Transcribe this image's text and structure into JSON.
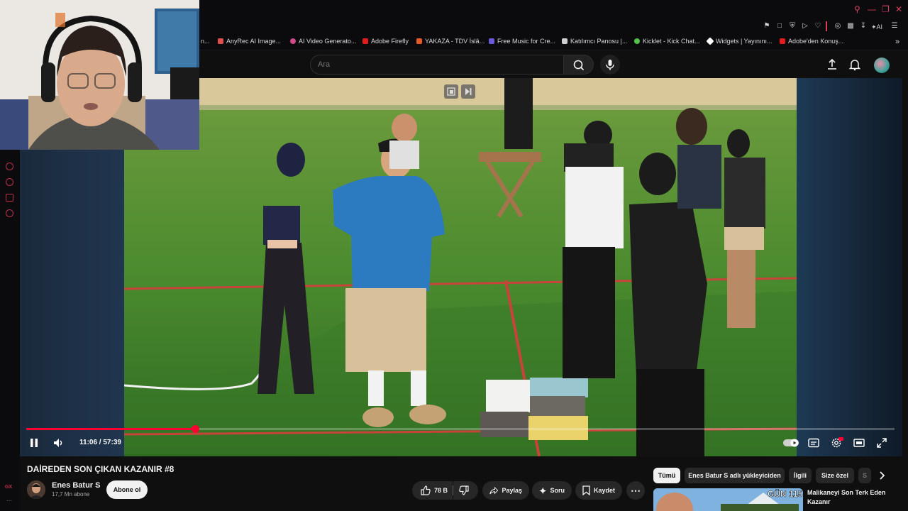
{
  "browser": {
    "bookmarks": [
      {
        "label": "n...",
        "color": "#888888"
      },
      {
        "label": "AnyRec AI Image...",
        "color": "#e05050"
      },
      {
        "label": "AI Video Generato...",
        "color": "#d04a8a"
      },
      {
        "label": "Adobe Firefly",
        "color": "#e21b1b"
      },
      {
        "label": "YAKAZA - TDV İslâ...",
        "color": "#e25a2a"
      },
      {
        "label": "Free Music for Cre...",
        "color": "#6a5ad8"
      },
      {
        "label": "Katılımcı Panosu |...",
        "color": "#cfcfcf"
      },
      {
        "label": "Kicklet - Kick Chat...",
        "color": "#53c24a"
      },
      {
        "label": "Widgets | Yayınını...",
        "color": "#ffffff"
      },
      {
        "label": "Adobe'den Konuş...",
        "color": "#e21b1b"
      }
    ]
  },
  "header": {
    "search_placeholder": "Ara"
  },
  "player": {
    "time": "11:06 / 57:39",
    "progress": 0.19
  },
  "video": {
    "title": "DAİREDEN SON ÇIKAN KAZANIR #8",
    "channel": "Enes Batur S",
    "subscribers": "17,7 Mn abone",
    "subscribe_label": "Abone ol",
    "likes": "78 B",
    "share_label": "Paylaş",
    "ask_label": "Soru",
    "save_label": "Kaydet"
  },
  "chips": [
    "Tümü",
    "Enes Batur S adlı yükleyiciden",
    "İlgili",
    "Size özel",
    "S"
  ],
  "recommendation": {
    "title": "Malikaneyi Son Terk Eden Kazanır",
    "thumb_text": "GÜN 115"
  },
  "colors": {
    "accent": "#ff0033",
    "browser_accent": "#d8405a"
  }
}
